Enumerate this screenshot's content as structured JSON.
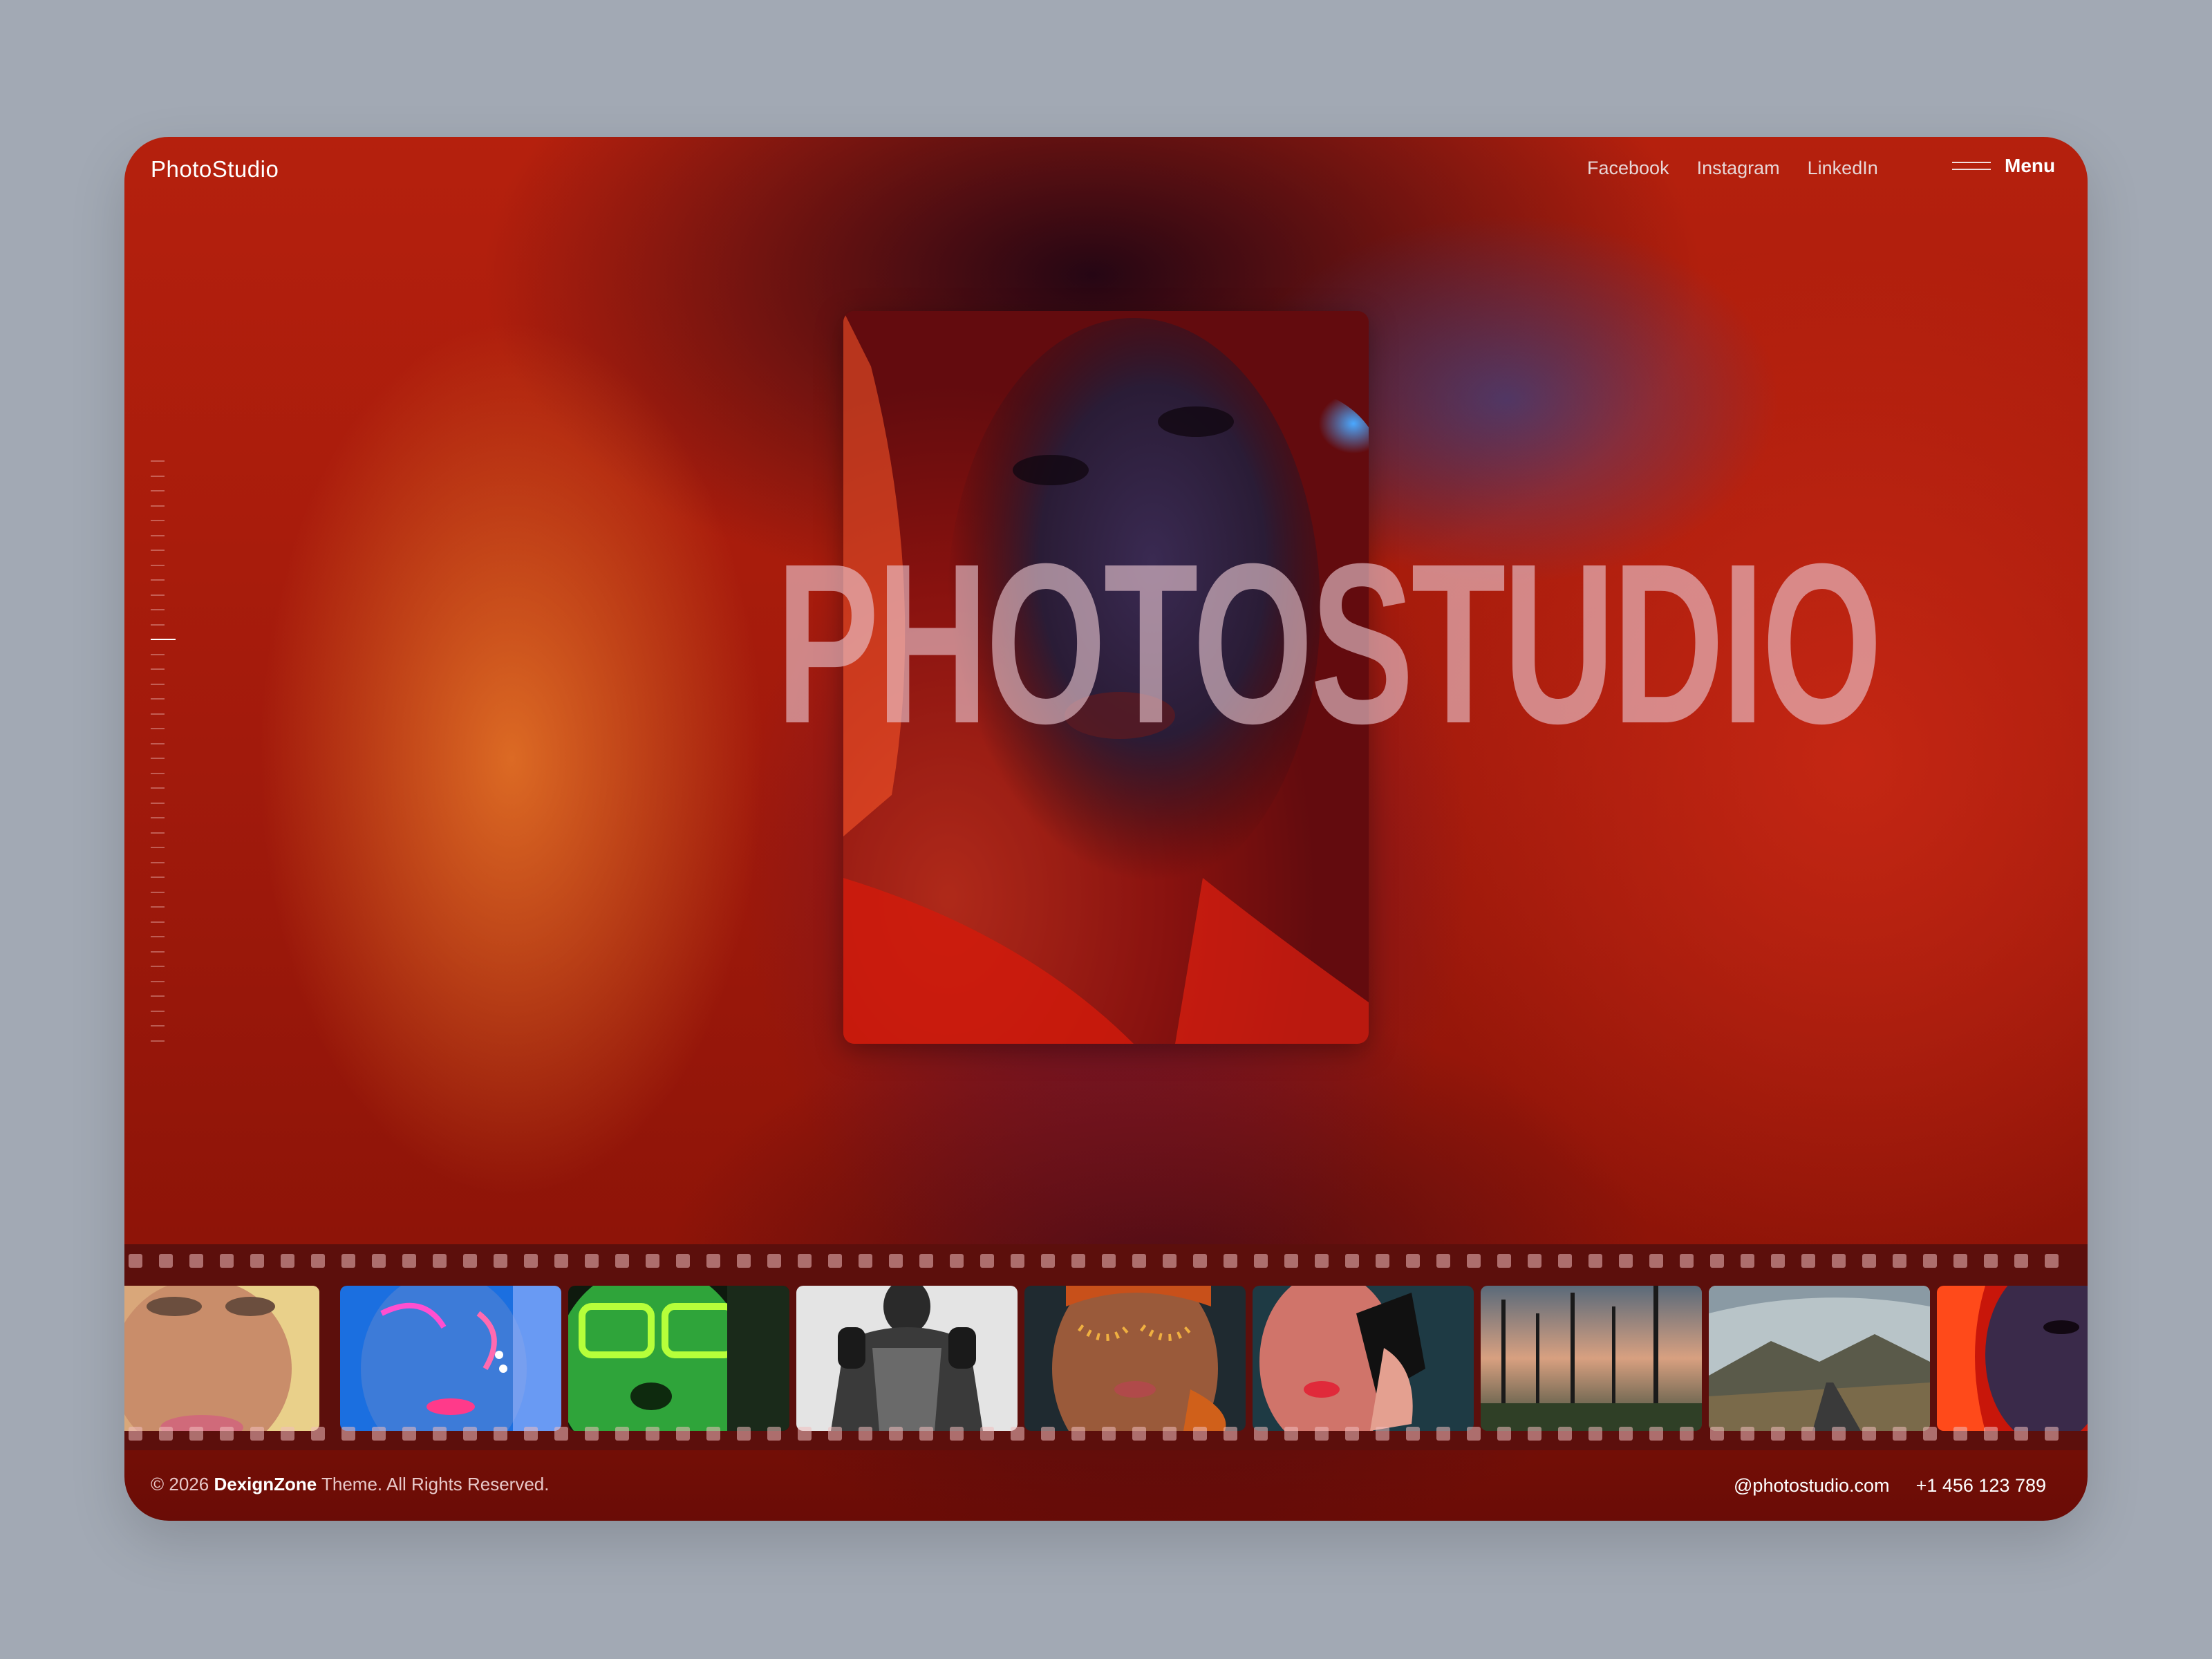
{
  "brand": {
    "logo_text": "PhotoStudio"
  },
  "nav": {
    "links": [
      {
        "label": "Facebook"
      },
      {
        "label": "Instagram"
      },
      {
        "label": "LinkedIn"
      }
    ],
    "menu_label": "Menu"
  },
  "hero": {
    "title": "PHOTOSTUDIO",
    "photo_icon": "portrait-photo"
  },
  "scroll_indicator": {
    "tick_count": 40,
    "active_index": 12
  },
  "filmstrip": {
    "frames": [
      {
        "name": "freckles-portrait"
      },
      {
        "name": "blue-neon-portrait"
      },
      {
        "name": "green-glasses-portrait"
      },
      {
        "name": "monochrome-man-portrait"
      },
      {
        "name": "gold-dots-makeup-portrait"
      },
      {
        "name": "teal-red-portrait"
      },
      {
        "name": "forest-landscape"
      },
      {
        "name": "mountain-road-landscape"
      },
      {
        "name": "red-portrait"
      }
    ]
  },
  "footer": {
    "copyright_prefix": "© 2026 ",
    "copyright_brand": "DexignZone",
    "copyright_suffix": " Theme. All Rights Reserved.",
    "email": "@photostudio.com",
    "phone": "+1 456 123 789"
  },
  "colors": {
    "page_background": "#a2a9b4",
    "accent_red": "#b5200d",
    "film_strip": "#5c0f0c"
  }
}
